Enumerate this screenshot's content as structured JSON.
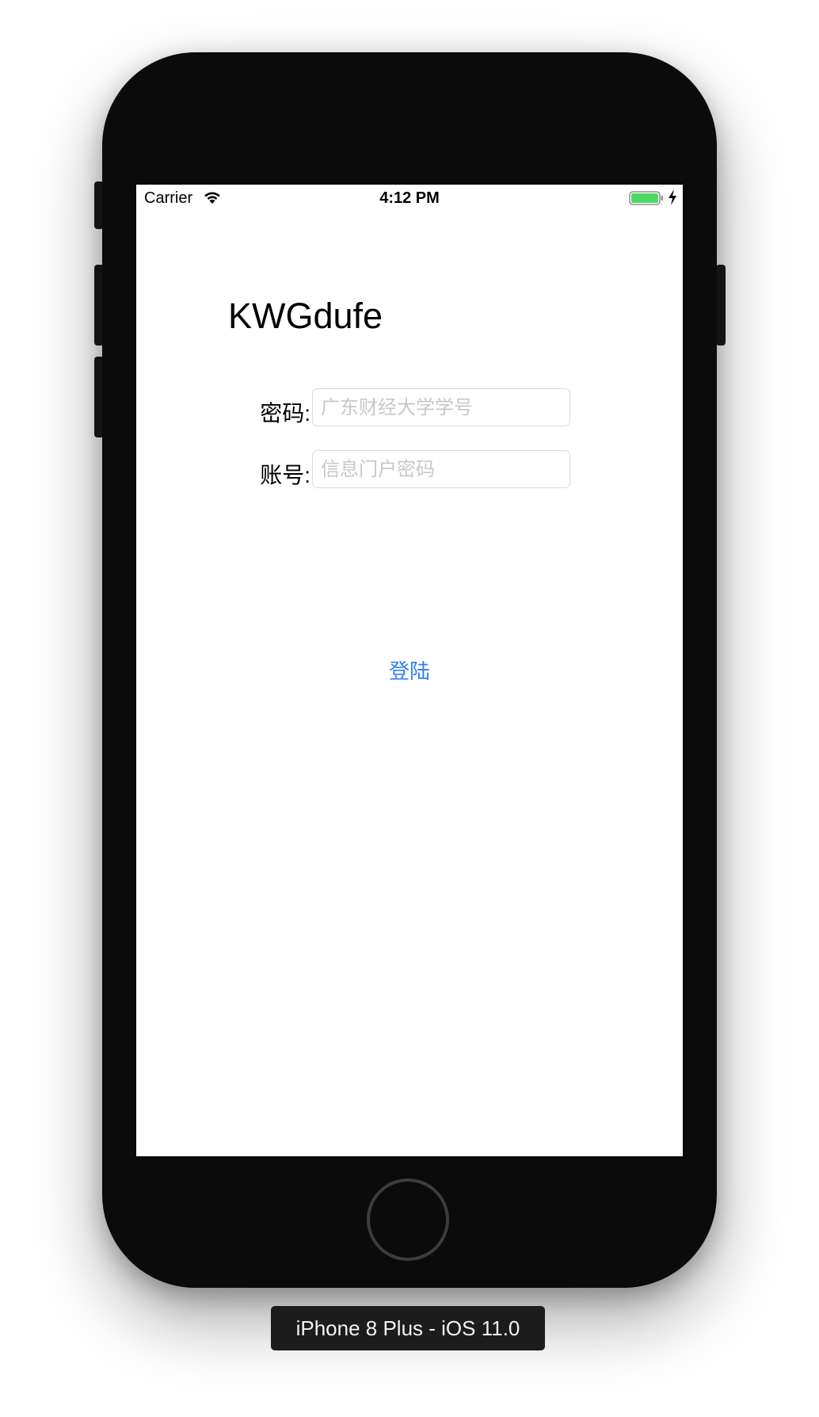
{
  "status_bar": {
    "carrier": "Carrier",
    "time": "4:12 PM",
    "battery_color": "#4cd964"
  },
  "app": {
    "title": "KWGdufe"
  },
  "form": {
    "field1_label": "密码:",
    "field1_placeholder": "广东财经大学学号",
    "field2_label": "账号:",
    "field2_placeholder": "信息门户密码",
    "login_label": "登陆",
    "accent_color": "#2f7ff0"
  },
  "device": {
    "label": "iPhone 8 Plus - iOS 11.0"
  }
}
